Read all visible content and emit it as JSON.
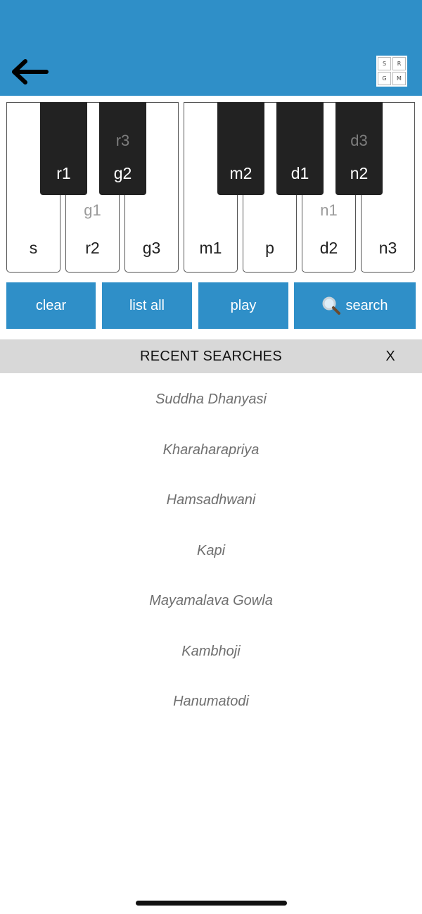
{
  "header": {
    "back_icon": "arrow-left-icon",
    "logo_letters": [
      "S",
      "R",
      "G",
      "M"
    ]
  },
  "keyboard": {
    "white_keys": [
      {
        "label": "s",
        "alt": ""
      },
      {
        "label": "r2",
        "alt": "g1"
      },
      {
        "label": "g3",
        "alt": ""
      },
      {
        "label": "m1",
        "alt": ""
      },
      {
        "label": "p",
        "alt": ""
      },
      {
        "label": "d2",
        "alt": "n1"
      },
      {
        "label": "n3",
        "alt": ""
      }
    ],
    "black_keys": [
      {
        "label": "r1",
        "alt": ""
      },
      {
        "label": "g2",
        "alt": "r3"
      },
      {
        "label": "m2",
        "alt": ""
      },
      {
        "label": "d1",
        "alt": ""
      },
      {
        "label": "n2",
        "alt": "d3"
      }
    ]
  },
  "actions": {
    "clear": "clear",
    "list_all": "list all",
    "play": "play",
    "search": "search",
    "search_icon": "magnifier-icon"
  },
  "recent": {
    "title": "RECENT SEARCHES",
    "close": "X",
    "items": [
      "Suddha Dhanyasi",
      "Kharaharapriya",
      "Hamsadhwani",
      "Kapi",
      "Mayamalava Gowla",
      "Kambhoji",
      "Hanumatodi"
    ]
  },
  "colors": {
    "brand_blue": "#2f8fc8",
    "black_key": "#222222",
    "recent_header_bg": "#d8d8d8"
  }
}
